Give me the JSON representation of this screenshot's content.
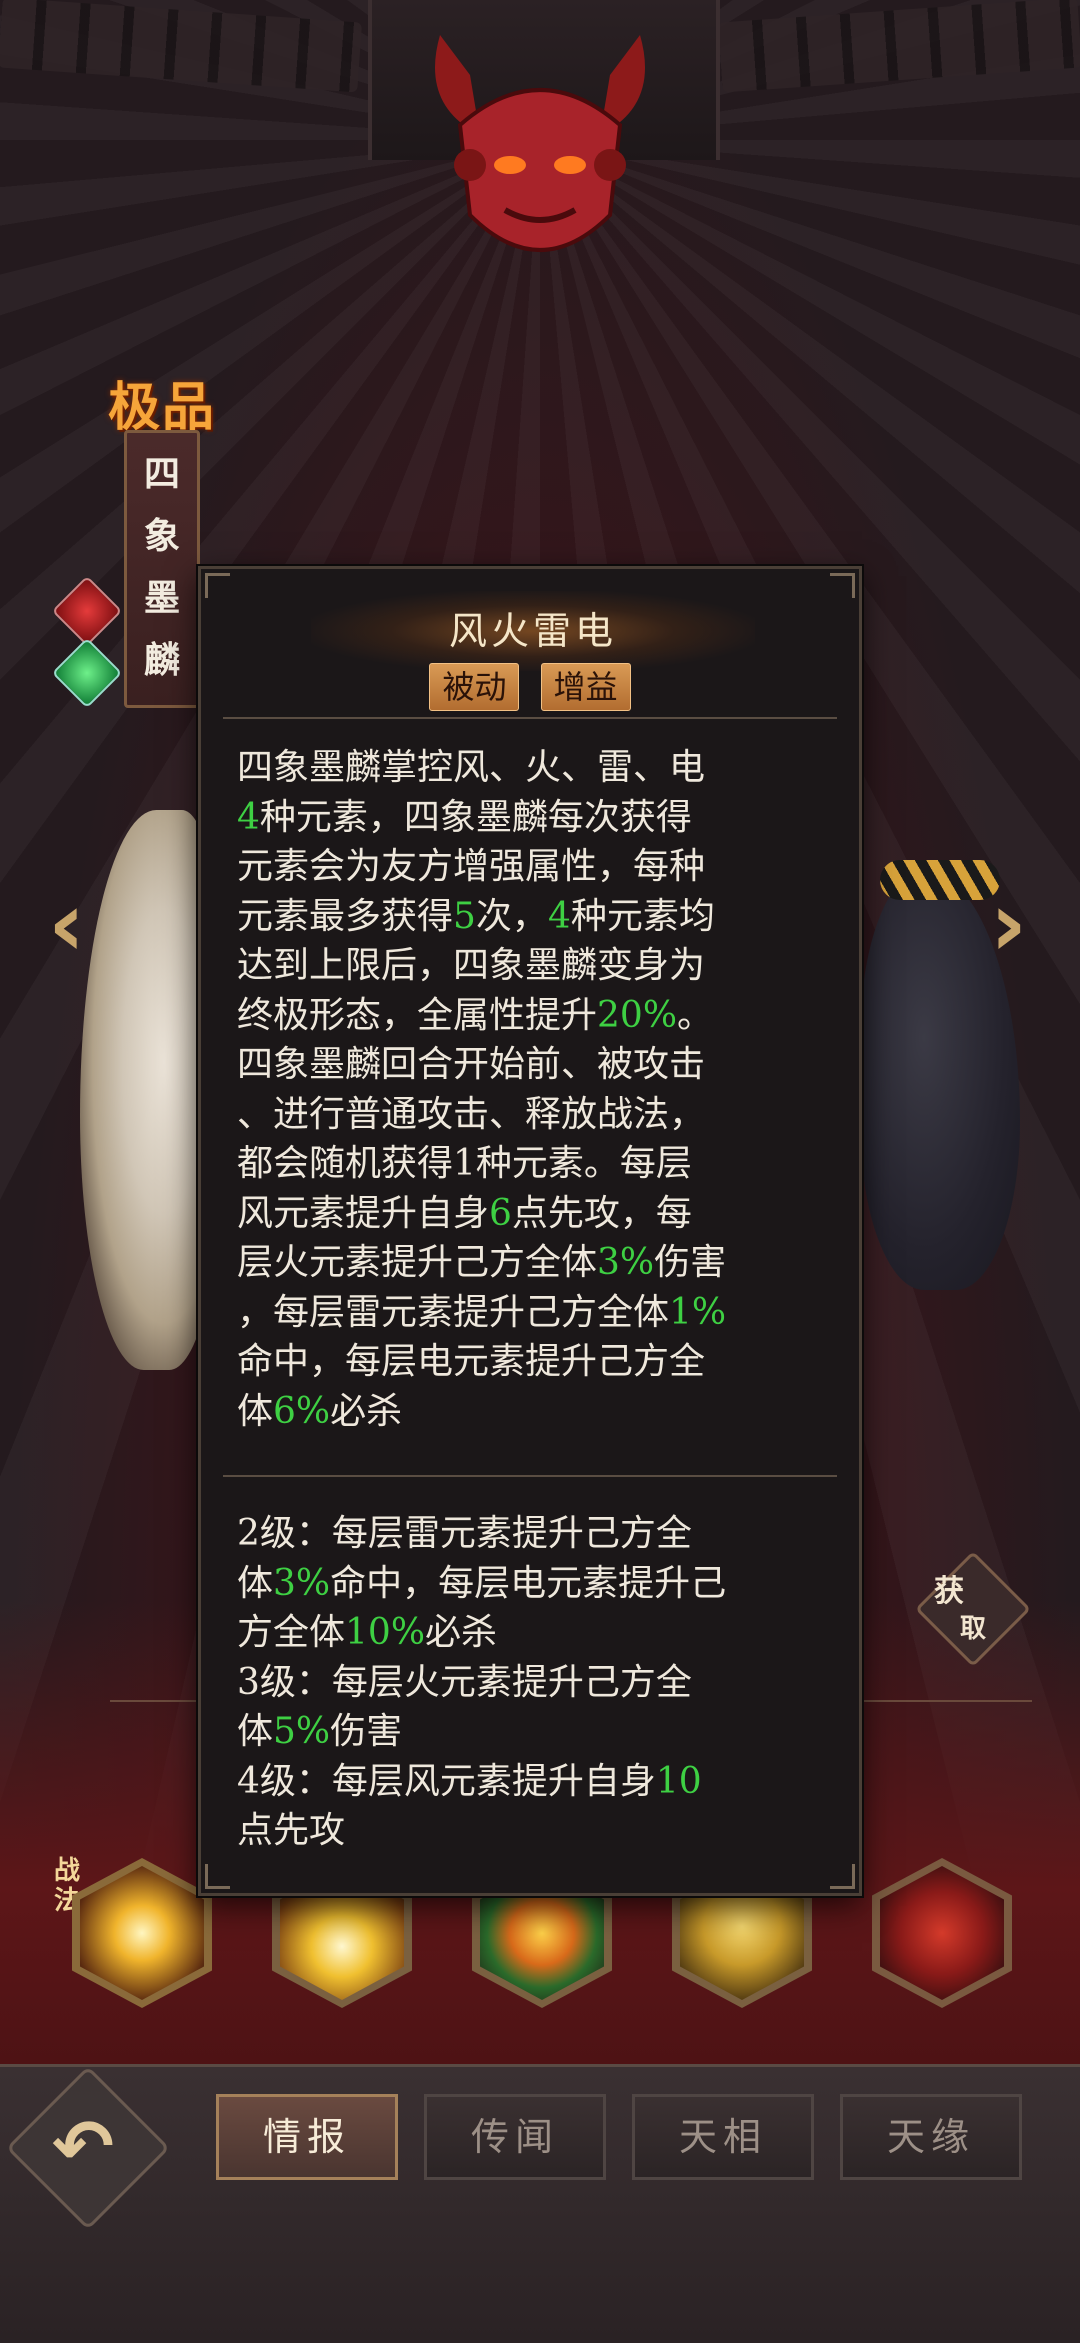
{
  "hero": {
    "rank": "极品",
    "name_chars": [
      "四",
      "象",
      "墨",
      "麟"
    ]
  },
  "skill": {
    "title": "风火雷电",
    "tags": [
      "被动",
      "增益"
    ],
    "description_segments": [
      {
        "t": "四象墨麟掌控风、火、雷、电\n"
      },
      {
        "t": "4",
        "hl": true
      },
      {
        "t": "种元素，四象墨麟每次获得\n元素会为友方增强属性，每种\n元素最多获得"
      },
      {
        "t": "5",
        "hl": true
      },
      {
        "t": "次，"
      },
      {
        "t": "4",
        "hl": true
      },
      {
        "t": "种元素均\n达到上限后，四象墨麟变身为\n终极形态，全属性提升"
      },
      {
        "t": "20%",
        "hl": true
      },
      {
        "t": "。\n四象墨麟回合开始前、被攻击\n、进行普通攻击、释放战法，\n都会随机获得1种元素。每层\n风元素提升自身"
      },
      {
        "t": "6",
        "hl": true
      },
      {
        "t": "点先攻，每\n层火元素提升己方全体"
      },
      {
        "t": "3%",
        "hl": true
      },
      {
        "t": "伤害\n，每层雷元素提升己方全体"
      },
      {
        "t": "1%",
        "hl": true
      },
      {
        "t": "\n命中，每层电元素提升己方全\n体"
      },
      {
        "t": "6%",
        "hl": true
      },
      {
        "t": "必杀"
      }
    ],
    "level_lines": [
      [
        {
          "t": "2级：每层雷元素提升己方全"
        }
      ],
      [
        {
          "t": "体"
        },
        {
          "t": "3%",
          "hl": true
        },
        {
          "t": "命中，每层电元素提升己"
        }
      ],
      [
        {
          "t": "方全体"
        },
        {
          "t": "10%",
          "hl": true
        },
        {
          "t": "必杀"
        }
      ],
      [
        {
          "t": "3级：每层火元素提升己方全"
        }
      ],
      [
        {
          "t": "体"
        },
        {
          "t": "5%",
          "hl": true
        },
        {
          "t": "伤害"
        }
      ],
      [
        {
          "t": "4级：每层风元素提升自身"
        },
        {
          "t": "10",
          "hl": true
        }
      ],
      [
        {
          "t": "点先攻"
        }
      ]
    ]
  },
  "obtain_label": [
    "获",
    "取"
  ],
  "tactics_label": [
    "战",
    "法"
  ],
  "tabs": [
    "情报",
    "传闻",
    "天相",
    "天缘"
  ],
  "active_tab": "情报",
  "colors": {
    "highlight": "#3ed043",
    "rank": "#f6a53a",
    "tag_bg": "#c9853f"
  }
}
